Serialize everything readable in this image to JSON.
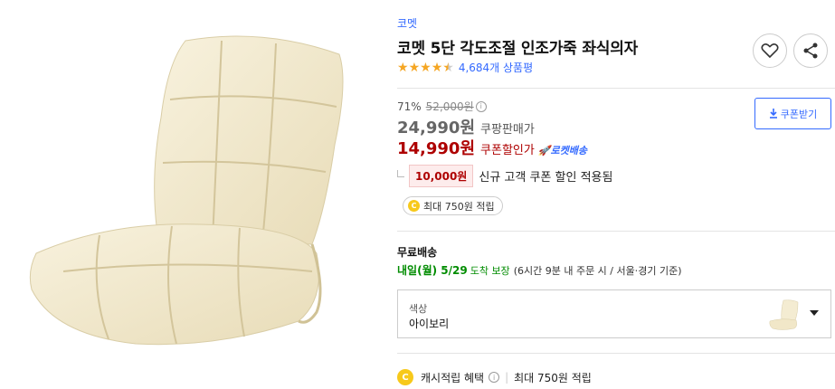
{
  "product": {
    "brand": "코멧",
    "title": "코멧 5단 각도조절 인조가죽 좌식의자",
    "rating_stars": 4.5,
    "review_count": "4,684개 상품평",
    "image_alt": "아이보리 좌식의자"
  },
  "actions": {
    "wishlist_icon": "heart-icon",
    "share_icon": "share-icon"
  },
  "price": {
    "discount_rate": "71%",
    "original_price": "52,000원",
    "info_glyph": "i",
    "sale_price": "24,990원",
    "sale_label": "쿠팡판매가",
    "coupon_price": "14,990원",
    "coupon_label": "쿠폰할인가",
    "rocket_label": "로켓배송",
    "coupon_button_label": "쿠폰받기"
  },
  "new_customer": {
    "amount": "10,000원",
    "text": "신규 고객 쿠폰 할인 적용됨"
  },
  "cashback_pill": {
    "coin_glyph": "C",
    "text": "최대 750원 적립"
  },
  "shipping": {
    "label": "무료배송",
    "date": "내일(월) 5/29",
    "guarantee": "도착 보장",
    "note": "(6시간 9분  내 주문 시 / 서울⋅경기 기준)"
  },
  "option": {
    "label": "색상",
    "value": "아이보리"
  },
  "cash_row": {
    "coin_glyph": "C",
    "label": "캐시적립 혜택",
    "info_glyph": "i",
    "separator": "|",
    "max_text": "최대 750원 적립"
  },
  "colors": {
    "accent_blue": "#346aff",
    "price_red": "#ae0000",
    "delivery_green": "#008c00",
    "star_orange": "#f5a623",
    "product_ivory": "#f4ecd2"
  }
}
